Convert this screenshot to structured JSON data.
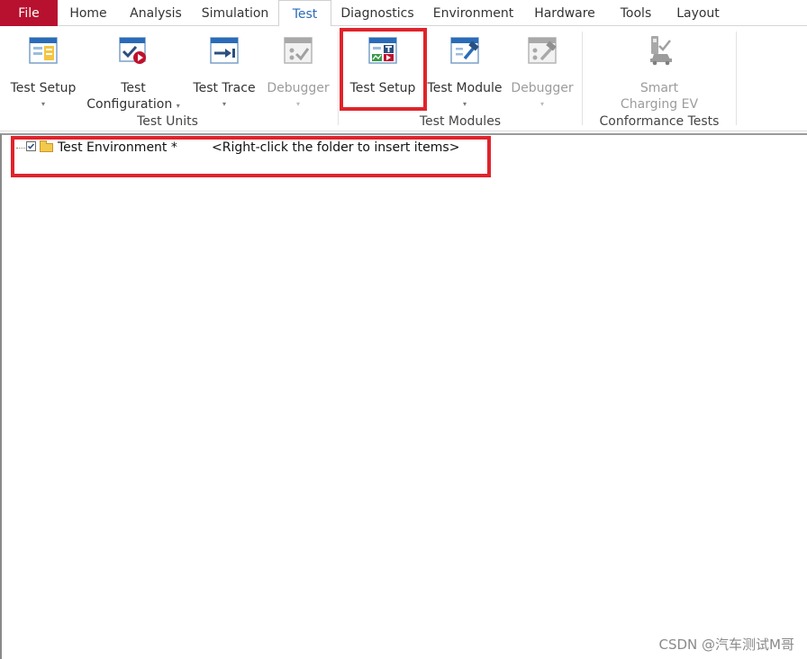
{
  "menu": {
    "file": "File",
    "home": "Home",
    "analysis": "Analysis",
    "simulation": "Simulation",
    "test": "Test",
    "diagnostics": "Diagnostics",
    "environment": "Environment",
    "hardware": "Hardware",
    "tools": "Tools",
    "layout": "Layout"
  },
  "ribbon": {
    "test_units": {
      "label": "Test Units",
      "test_setup": "Test Setup",
      "test_configuration_1": "Test",
      "test_configuration_2": "Configuration",
      "test_trace": "Test Trace",
      "debugger": "Debugger"
    },
    "test_modules": {
      "label": "Test Modules",
      "test_setup": "Test Setup",
      "test_module": "Test Module",
      "debugger": "Debugger"
    },
    "conformance": {
      "label": "Conformance Tests",
      "smart_1": "Smart",
      "smart_2": "Charging EV"
    },
    "caret": "▾"
  },
  "tree": {
    "root_name": "Test Environment *",
    "hint": "<Right-click the folder to insert items>",
    "checked": true
  },
  "watermark": "CSDN @汽车测试M哥",
  "colors": {
    "file_tab": "#b8102f",
    "active_tab_text": "#2a6bb8",
    "highlight_box": "#e0232b",
    "icon_blue": "#2a6bb8",
    "icon_red": "#c0112d"
  }
}
